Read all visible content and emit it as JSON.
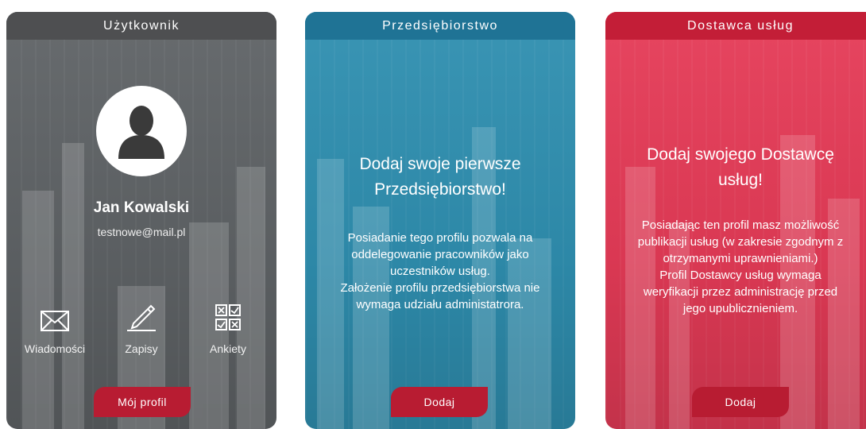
{
  "user": {
    "header": "Użytkownik",
    "name": "Jan Kowalski",
    "email": "testnowe@mail.pl",
    "actions": [
      {
        "label": "Wiadomości",
        "icon": "envelope-icon"
      },
      {
        "label": "Zapisy",
        "icon": "pencil-icon"
      },
      {
        "label": "Ankiety",
        "icon": "survey-icon"
      }
    ],
    "button": "Mój profil"
  },
  "company": {
    "header": "Przedsiębiorstwo",
    "headline_1": "Dodaj swoje pierwsze",
    "headline_2": "Przedsiębiorstwo!",
    "text_lines": [
      "Posiadanie tego profilu pozwala na",
      "oddelegowanie pracowników jako",
      "uczestników usług.",
      "Założenie profilu przedsiębiorstwa nie",
      "wymaga udziału administatrora."
    ],
    "button": "Dodaj"
  },
  "provider": {
    "header": "Dostawca usług",
    "headline_1": "Dodaj swojego Dostawcę",
    "headline_2": "usług!",
    "text_lines": [
      "Posiadając ten profil masz możliwość",
      "publikacji usług (w zakresie zgodnym z",
      "otrzymanymi uprawnieniami.)",
      "Profil Dostawcy usług wymaga",
      "weryfikacji przez administrację przed",
      "jego upublicznieniem."
    ],
    "button": "Dodaj"
  },
  "colors": {
    "user_header": "#4e4f51",
    "company_header": "#1f7395",
    "provider_header": "#c31e37",
    "button": "#b81c32"
  }
}
